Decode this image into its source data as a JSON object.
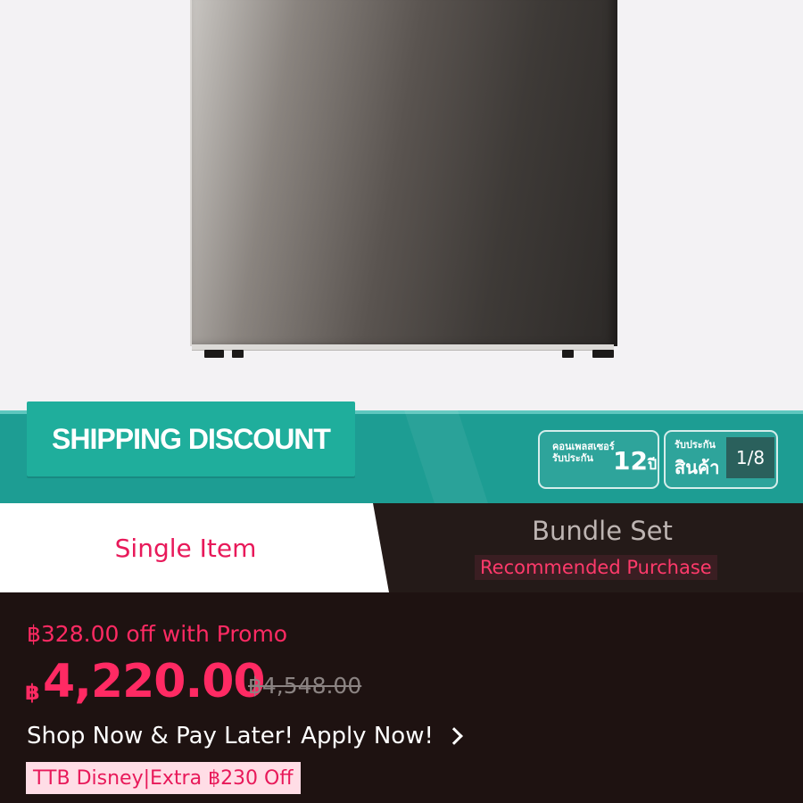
{
  "banner": {
    "shipping_label": "SHIPPING DISCOUNT",
    "warranty1_small": "คอนเพลสเซอร์\nรับประกัน",
    "warranty1_number": "12",
    "warranty1_unit": "ปี",
    "warranty2_small": "รับประกัน",
    "warranty2_big": "สินค้า",
    "page_counter": "1/8"
  },
  "tabs": {
    "single_label": "Single Item",
    "bundle_label": "Bundle Set",
    "bundle_sub": "Recommended Purchase"
  },
  "price": {
    "promo_text": "฿328.00 off with Promo",
    "currency": "฿",
    "current": "4,220.00",
    "original": "฿4,548.00",
    "paylater_text": "Shop Now & Pay Later! Apply Now!",
    "coupon_text": "TTB Disney|Extra ฿230 Off"
  },
  "colors": {
    "accent": "#ff2a63",
    "banner_teal": "#1d9d93",
    "dark_bg": "#1e1211"
  }
}
